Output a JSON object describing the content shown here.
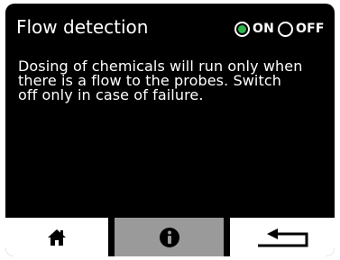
{
  "header": {
    "title": "Flow detection"
  },
  "toggle": {
    "options": [
      {
        "label": "ON",
        "selected": true
      },
      {
        "label": "OFF",
        "selected": false
      }
    ],
    "selected_color": "#2fb34a"
  },
  "description": {
    "lines": [
      "Dosing of chemicals will run only when",
      "there is a flow to the probes. Switch",
      "off only in case of failure."
    ]
  },
  "navbar": {
    "buttons": [
      {
        "icon": "home-icon",
        "active": false
      },
      {
        "icon": "info-icon",
        "active": true
      },
      {
        "icon": "back-icon",
        "active": false
      }
    ],
    "active_color": "#9a9a9a"
  }
}
